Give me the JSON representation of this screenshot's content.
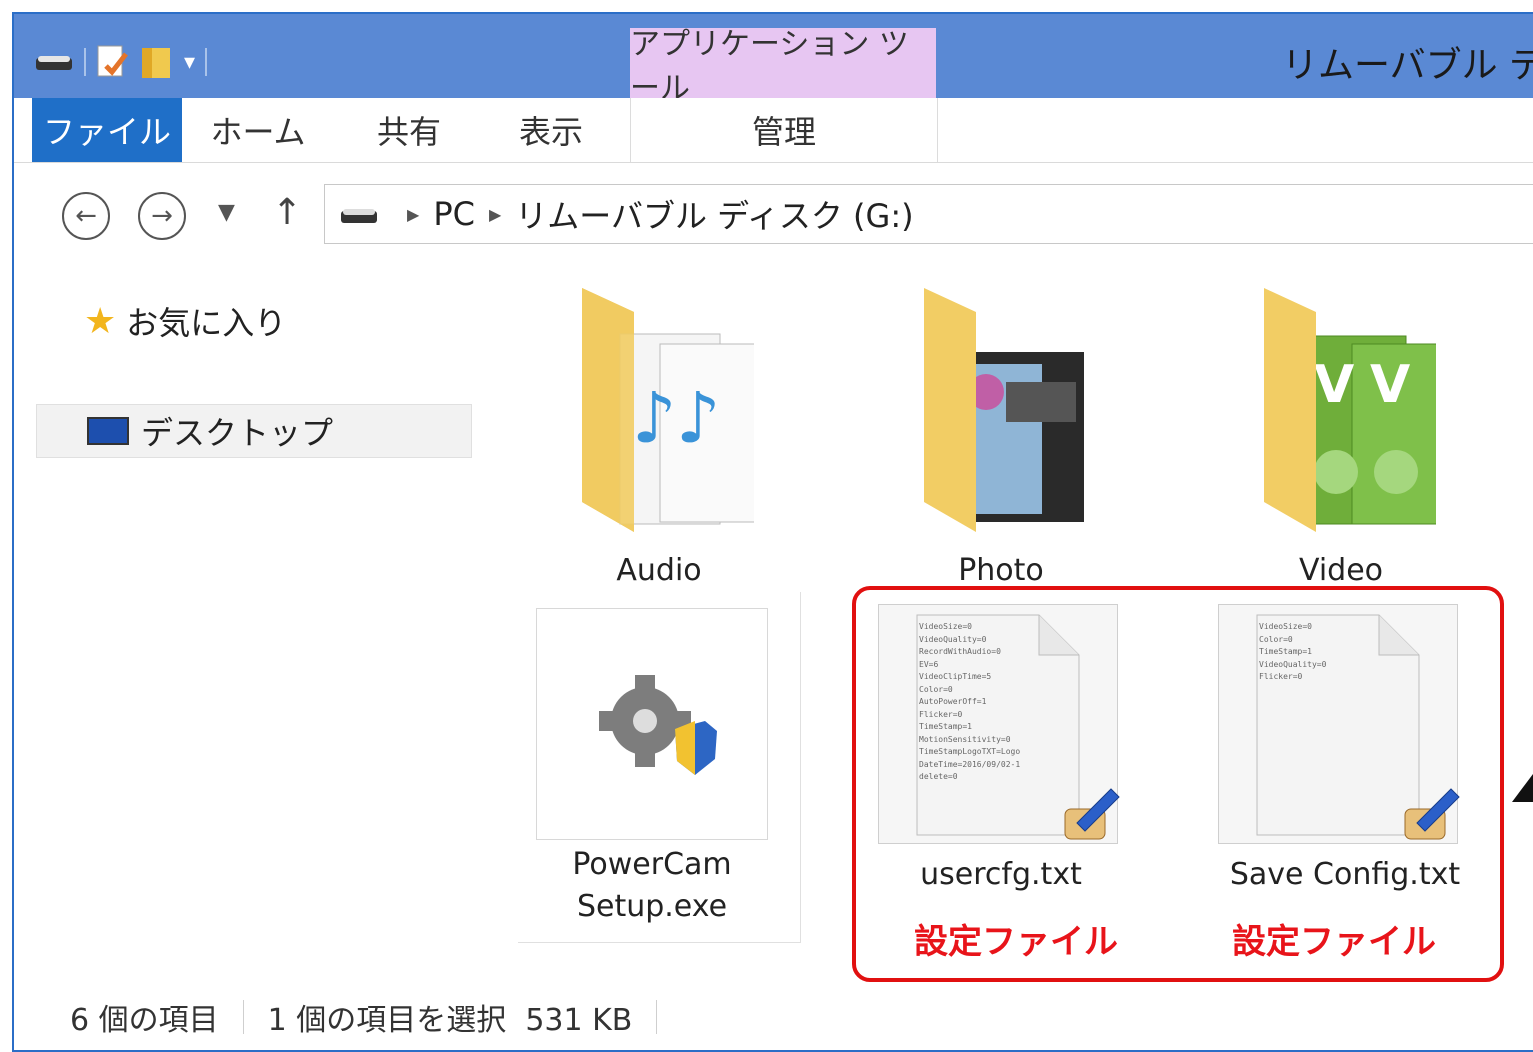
{
  "titlebar": {
    "context_tab": "アプリケーション ツール",
    "window_title": "リムーバブル ディ"
  },
  "ribbon": {
    "tabs": [
      "ファイル",
      "ホーム",
      "共有",
      "表示",
      "管理"
    ]
  },
  "address": {
    "segments": [
      "PC",
      "リムーバブル ディスク (G:)"
    ]
  },
  "navpane": {
    "favorites": "お気に入り",
    "desktop": "デスクトップ"
  },
  "items": [
    {
      "name": "Audio",
      "type": "folder"
    },
    {
      "name": "Photo",
      "type": "folder"
    },
    {
      "name": "Video",
      "type": "folder"
    },
    {
      "name_line1": "PowerCam",
      "name_line2": "Setup.exe",
      "type": "exe"
    },
    {
      "name": "usercfg.txt",
      "type": "txt",
      "annotation": "設定ファイル"
    },
    {
      "name": "Save Config.txt",
      "type": "txt",
      "annotation": "設定ファイル"
    }
  ],
  "preview_text": {
    "usercfg": "VideoSize=0\nVideoQuality=0\nRecordWithAudio=0\nEV=6\nVideoClipTime=5\nColor=0\nAutoPowerOff=1\nFlicker=0\nTimeStamp=1\nMotionSensitivity=0\nTimeStampLogoTXT=Logo\nDateTime=2016/09/02-1\ndelete=0",
    "saveconfig": "VideoSize=0\nColor=0\nTimeStamp=1\nVideoQuality=0\nFlicker=0"
  },
  "status": {
    "count": "6 個の項目",
    "selection": "1 個の項目を選択  531 KB"
  },
  "colors": {
    "titlebar": "#5a89d4",
    "file_tab": "#1f6fc8",
    "context_tab": "#e7c6f2",
    "highlight": "#e11010"
  }
}
